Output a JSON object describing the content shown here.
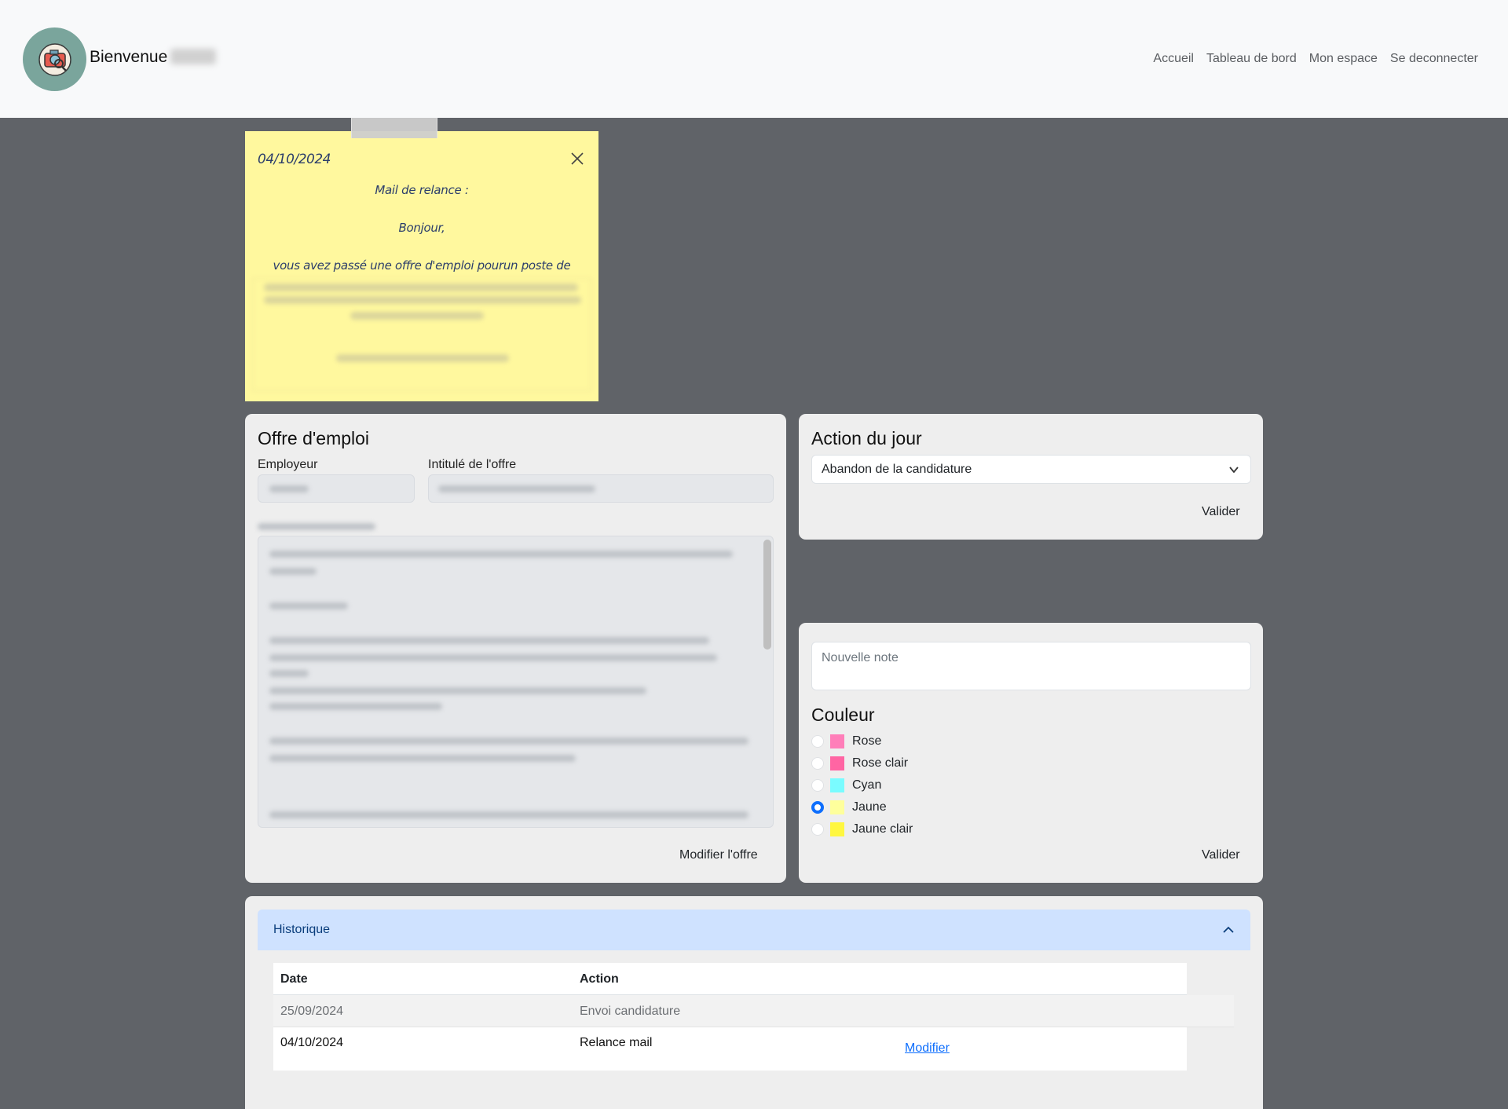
{
  "navbar": {
    "welcome": "Bienvenue",
    "links": [
      "Accueil",
      "Tableau de bord",
      "Mon espace",
      "Se deconnecter"
    ]
  },
  "note": {
    "date": "04/10/2024",
    "line1": "Mail de relance :",
    "line2": "Bonjour,",
    "line3": "vous avez passé une offre d'emploi pourun poste de",
    "color": "#fff89e"
  },
  "offer": {
    "title": "Offre d'emploi",
    "employer_label": "Employeur",
    "title_label": "Intitulé de l'offre",
    "modify_button": "Modifier l'offre"
  },
  "action": {
    "title": "Action du jour",
    "selected": "Abandon de la candidature",
    "validate_button": "Valider"
  },
  "new_note": {
    "placeholder": "Nouvelle note",
    "color_title": "Couleur",
    "colors": [
      {
        "label": "Rose",
        "hex": "#ff7eb9",
        "checked": false
      },
      {
        "label": "Rose clair",
        "hex": "#ff65a3",
        "checked": false
      },
      {
        "label": "Cyan",
        "hex": "#7afcff",
        "checked": false
      },
      {
        "label": "Jaune",
        "hex": "#feff9c",
        "checked": true
      },
      {
        "label": "Jaune clair",
        "hex": "#fff740",
        "checked": false
      }
    ],
    "validate_button": "Valider"
  },
  "history": {
    "title": "Historique",
    "columns": [
      "Date",
      "Action"
    ],
    "rows": [
      {
        "date": "25/09/2024",
        "action": "Envoi candidature"
      },
      {
        "date": "04/10/2024",
        "action": "Relance mail",
        "link": "Modifier"
      }
    ]
  }
}
